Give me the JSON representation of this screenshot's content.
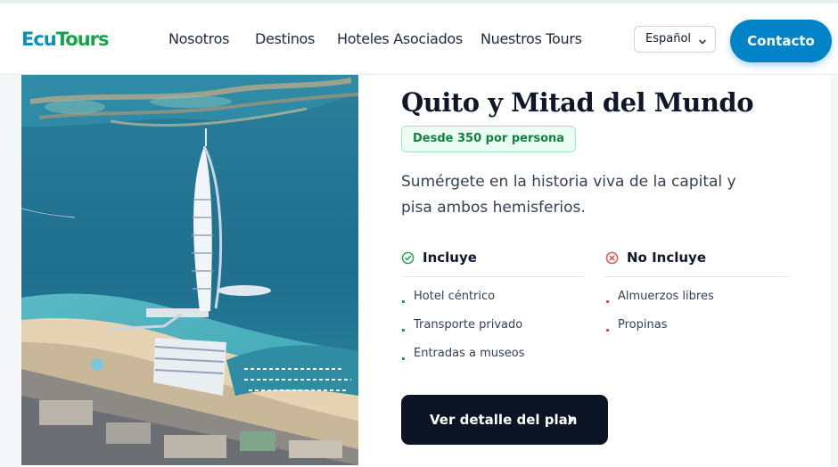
{
  "brand": {
    "part1": "Ecu",
    "part2": "Tours",
    "color1": "#0891b2",
    "color2": "#16a34a"
  },
  "nav": {
    "items": [
      "Nosotros",
      "Destinos",
      "Hoteles Asociados",
      "Nuestros Tours"
    ]
  },
  "language": {
    "selected": "Español",
    "icon": "chevron-down-icon"
  },
  "contact": {
    "label": "Contacto",
    "color": "#0383c7"
  },
  "tour": {
    "title": "Quito y Mitad del Mundo",
    "price_badge": "Desde 350 por persona",
    "description": "Sumérgete en la historia viva de la capital y pisa ambos hemisferios.",
    "image_alt": "aerial-city-coast-photo",
    "includes": {
      "heading": "Incluye",
      "icon": "check-circle-icon",
      "color": "#16a34a",
      "items": [
        "Hotel céntrico",
        "Transporte privado",
        "Entradas a museos"
      ]
    },
    "excludes": {
      "heading": "No Incluye",
      "icon": "x-circle-icon",
      "color": "#ef4444",
      "items": [
        "Almuerzos libres",
        "Propinas"
      ]
    },
    "cta": {
      "label": "Ver detalle del plan",
      "icon": "chevron-right-icon"
    }
  }
}
